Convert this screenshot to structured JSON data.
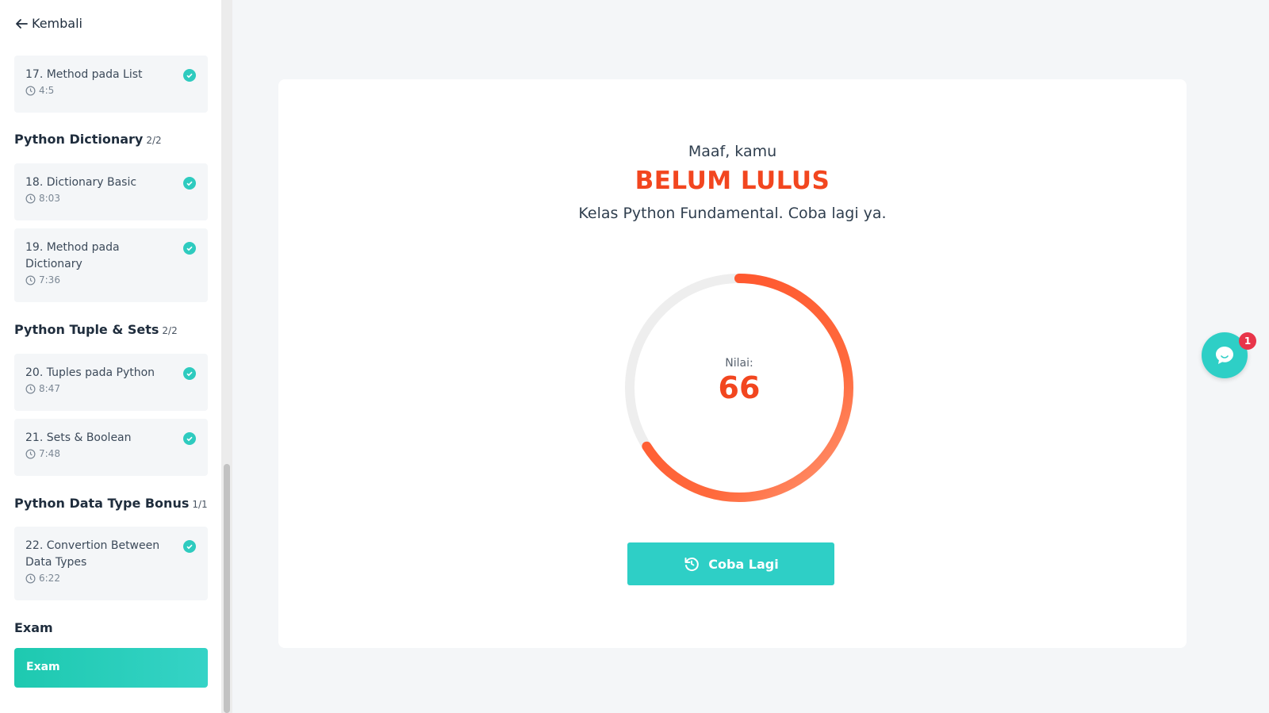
{
  "sidebar": {
    "back_label": "Kembali",
    "items": [
      {
        "title": "17. Method pada List",
        "duration": "4:5"
      },
      {
        "title": "18. Dictionary Basic",
        "duration": "8:03"
      },
      {
        "title": "19. Method pada Dictionary",
        "duration": "7:36"
      },
      {
        "title": "20. Tuples pada Python",
        "duration": "8:47"
      },
      {
        "title": "21. Sets & Boolean",
        "duration": "7:48"
      },
      {
        "title": "22. Convertion Between Data Types",
        "duration": "6:22"
      }
    ],
    "sections": [
      {
        "title": "Python Dictionary",
        "count": "2/2"
      },
      {
        "title": "Python Tuple & Sets",
        "count": "2/2"
      },
      {
        "title": "Python Data Type Bonus",
        "count": "1/1"
      },
      {
        "title": "Exam",
        "count": ""
      }
    ],
    "exam_button": "Exam"
  },
  "result": {
    "sorry": "Maaf, kamu",
    "status": "BELUM LULUS",
    "description": "Kelas Python Fundamental. Coba lagi ya.",
    "score_label": "Nilai:",
    "score": "66",
    "score_fraction": 0.66,
    "retry_label": "Coba Lagi"
  },
  "chat": {
    "badge": "1"
  },
  "colors": {
    "accent": "#2ecfc6",
    "fail": "#f2461f",
    "check": "#2ecbbf"
  }
}
